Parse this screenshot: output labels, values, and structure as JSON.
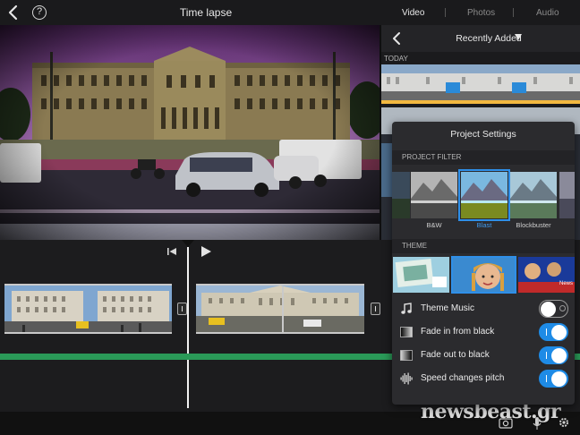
{
  "topbar": {
    "title": "Time lapse",
    "help_glyph": "?",
    "tabs": [
      {
        "label": "Video",
        "active": true
      },
      {
        "label": "Photos",
        "active": false
      },
      {
        "label": "Audio",
        "active": false
      }
    ]
  },
  "browser": {
    "title": "Recently Added",
    "section": "TODAY"
  },
  "settings": {
    "title": "Project Settings",
    "filter_section": "PROJECT FILTER",
    "filters": [
      {
        "label": "B&W",
        "selected": false
      },
      {
        "label": "Blast",
        "selected": true
      },
      {
        "label": "Blockbuster",
        "selected": false
      }
    ],
    "theme_section": "THEME",
    "theme_badge": "News",
    "options": [
      {
        "label": "Theme Music",
        "on": false,
        "icon": "music-note-icon"
      },
      {
        "label": "Fade in from black",
        "on": true,
        "icon": "fade-in-icon"
      },
      {
        "label": "Fade out to black",
        "on": true,
        "icon": "fade-out-icon"
      },
      {
        "label": "Speed changes pitch",
        "on": true,
        "icon": "waveform-icon"
      }
    ]
  },
  "watermark": "newsbeast.gr",
  "colors": {
    "accent": "#1e8be6",
    "audio_track": "#2a9a58",
    "viewer_tint": "#7a3f88"
  }
}
